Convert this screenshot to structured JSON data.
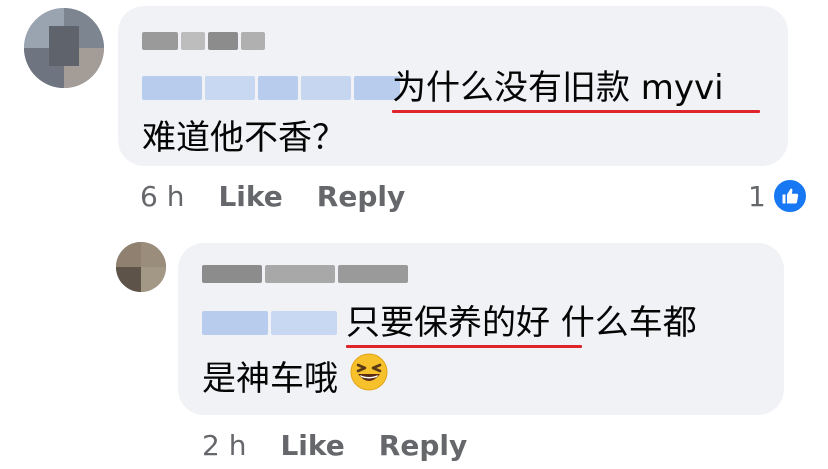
{
  "comments": [
    {
      "text_lines": [
        "为什么没有旧款 myvi",
        "难道他不香？"
      ],
      "meta": {
        "time": "6 h",
        "like_label": "Like",
        "reply_label": "Reply"
      },
      "reaction": {
        "count": "1",
        "icon": "thumbs-up-icon"
      }
    },
    {
      "text_lines": [
        "只要保养的好 什么车都",
        "是神车哦"
      ],
      "emoji": "grinning-squinting-face",
      "meta": {
        "time": "2 h",
        "like_label": "Like",
        "reply_label": "Reply"
      }
    }
  ],
  "colors": {
    "bubble": "#f0f2f5",
    "underline": "#e0242b",
    "meta": "#65676b",
    "like_blue": "#1877f2",
    "mention": "#b8cdee"
  }
}
